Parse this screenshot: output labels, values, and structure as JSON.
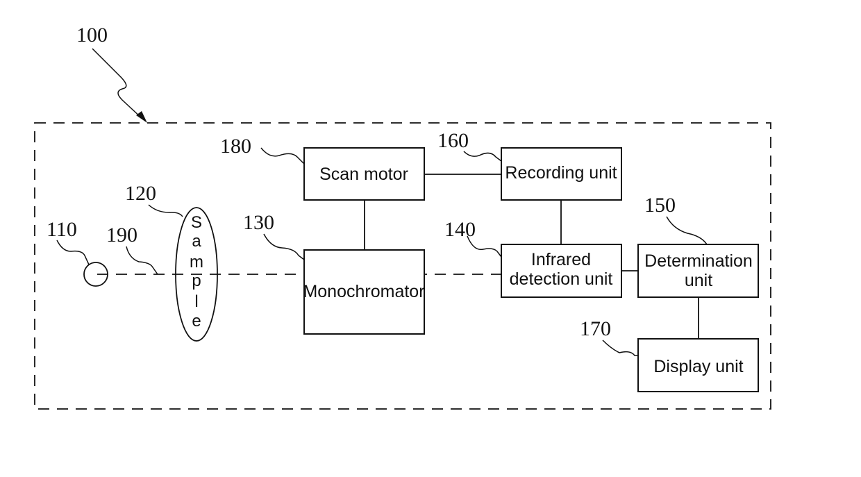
{
  "diagram": {
    "system_ref": "100",
    "source": {
      "ref": "110"
    },
    "sample": {
      "ref": "120",
      "letters": [
        "S",
        "a",
        "m",
        "p",
        "l",
        "e"
      ]
    },
    "beam": {
      "ref": "190"
    },
    "blocks": {
      "monochromator": {
        "ref": "130",
        "lines": [
          "Monochromator"
        ]
      },
      "infrared_detection": {
        "ref": "140",
        "lines": [
          "Infrared",
          "detection unit"
        ]
      },
      "determination": {
        "ref": "150",
        "lines": [
          "Determination",
          "unit"
        ]
      },
      "recording": {
        "ref": "160",
        "lines": [
          "Recording unit"
        ]
      },
      "display": {
        "ref": "170",
        "lines": [
          "Display unit"
        ]
      },
      "scan_motor": {
        "ref": "180",
        "lines": [
          "Scan motor"
        ]
      }
    },
    "connections": [
      [
        "scan_motor",
        "recording"
      ],
      [
        "scan_motor",
        "monochromator"
      ],
      [
        "recording",
        "infrared_detection"
      ],
      [
        "infrared_detection",
        "determination"
      ],
      [
        "determination",
        "display"
      ]
    ]
  }
}
